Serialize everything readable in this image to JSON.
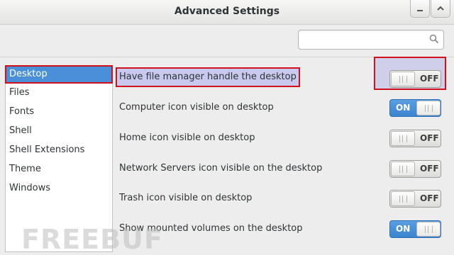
{
  "window": {
    "title": "Advanced Settings",
    "min_icon": "minimize-icon",
    "max_icon": "maximize-icon"
  },
  "search": {
    "placeholder": "",
    "icon": "search-icon"
  },
  "sidebar": {
    "items": [
      {
        "label": "Desktop",
        "selected": true
      },
      {
        "label": "Files"
      },
      {
        "label": "Fonts"
      },
      {
        "label": "Shell"
      },
      {
        "label": "Shell Extensions"
      },
      {
        "label": "Theme"
      },
      {
        "label": "Windows"
      }
    ]
  },
  "settings": [
    {
      "label": "Have file manager handle the desktop",
      "state": "OFF"
    },
    {
      "label": "Computer icon visible on desktop",
      "state": "ON"
    },
    {
      "label": "Home icon visible on desktop",
      "state": "OFF"
    },
    {
      "label": "Network Servers icon visible on the desktop",
      "state": "OFF"
    },
    {
      "label": "Trash icon visible on desktop",
      "state": "OFF"
    },
    {
      "label": "Show mounted volumes on the desktop",
      "state": "ON"
    }
  ],
  "colors": {
    "accent": "#4a90d9",
    "highlight_border": "#d0101b"
  },
  "watermark": "FREEBUF"
}
